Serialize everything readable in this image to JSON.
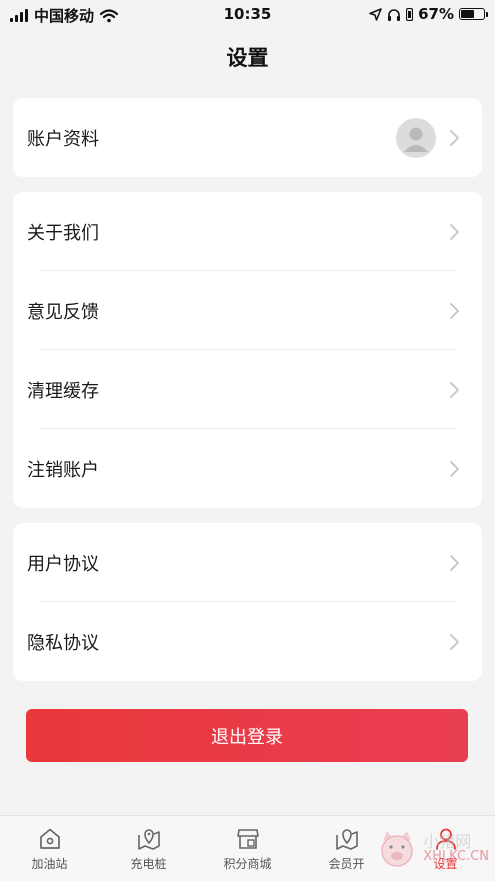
{
  "status_bar": {
    "carrier": "中国移动",
    "time": "10:35",
    "battery": "67%",
    "battery_level": 0.67
  },
  "nav": {
    "title": "设置"
  },
  "groups": [
    {
      "items": [
        {
          "label": "账户资料",
          "has_avatar": true
        }
      ]
    },
    {
      "items": [
        {
          "label": "关于我们"
        },
        {
          "label": "意见反馈"
        },
        {
          "label": "清理缓存"
        },
        {
          "label": "注销账户"
        }
      ]
    },
    {
      "items": [
        {
          "label": "用户协议"
        },
        {
          "label": "隐私协议"
        }
      ]
    }
  ],
  "logout": {
    "label": "退出登录",
    "color_start": "#e8383b",
    "color_end": "#ea3e52"
  },
  "tabbar": {
    "active_color": "#e8383b",
    "items": [
      {
        "label": "加油站",
        "icon": "home-icon"
      },
      {
        "label": "充电桩",
        "icon": "map-pin-icon"
      },
      {
        "label": "积分商城",
        "icon": "store-icon"
      },
      {
        "label": "会员开",
        "icon": "map-pin-icon"
      },
      {
        "label": "设置",
        "icon": "user-icon",
        "active": true
      }
    ]
  },
  "watermark": {
    "text_top": "小猪网",
    "text_bottom": "XHLKC.CN"
  }
}
